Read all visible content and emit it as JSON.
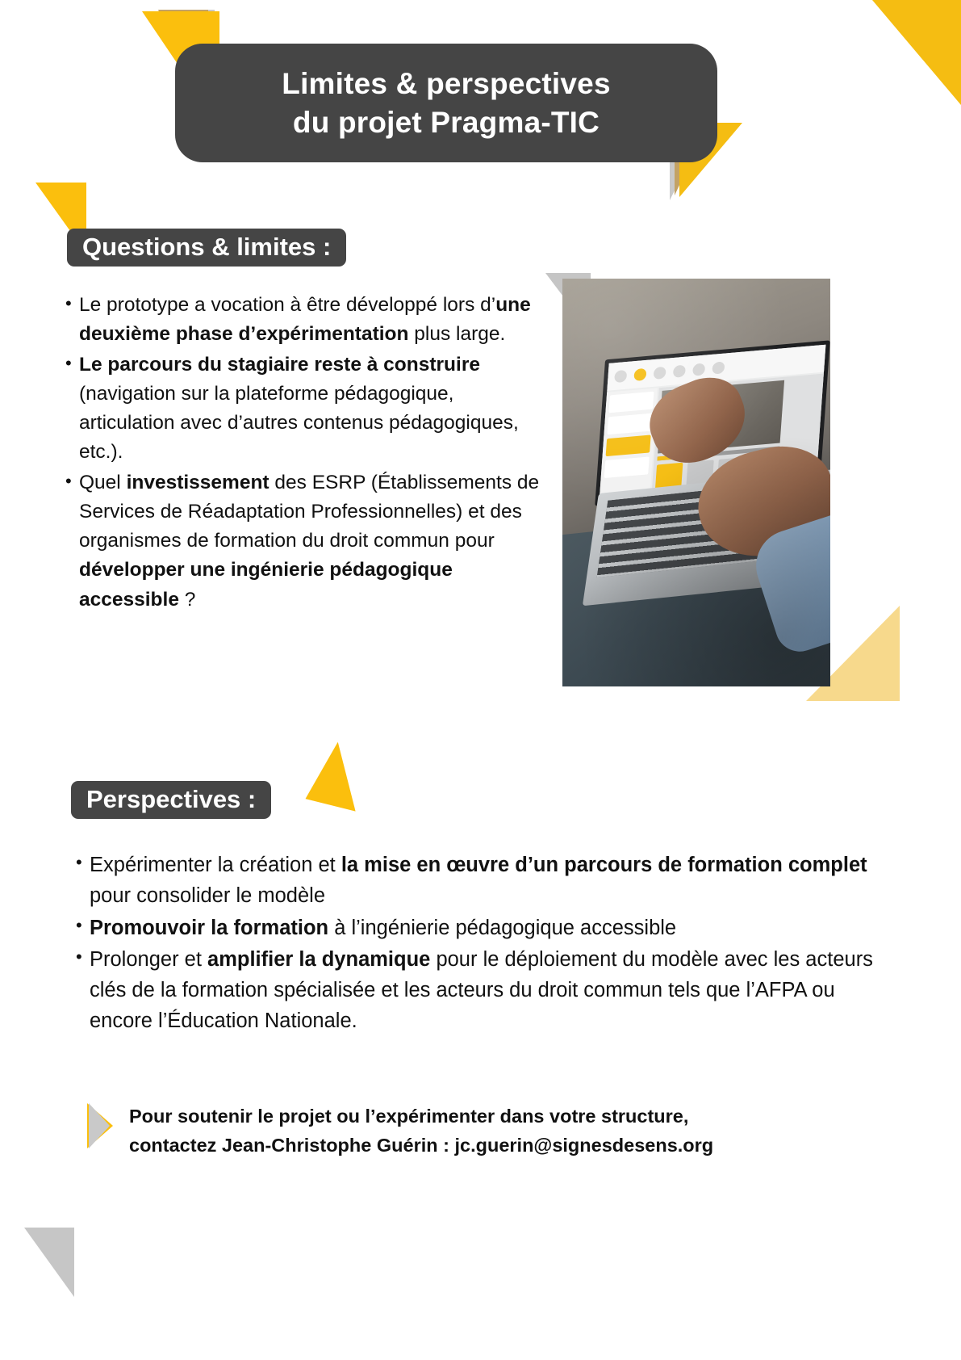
{
  "colors": {
    "dark": "#454545",
    "yellow": "#fbbf0d",
    "yellow_deep": "#f5bd12",
    "pale_yellow": "#f7d98c",
    "gray": "#c9c9c9",
    "tan": "#c3a265",
    "text": "#111111",
    "white": "#ffffff"
  },
  "title": {
    "line1": "Limites & perspectives",
    "line2": "du projet Pragma-TIC"
  },
  "sections": [
    {
      "id": "questions",
      "label": "Questions & limites :",
      "bullets": [
        [
          {
            "text": "Le prototype a vocation à être développé lors d’",
            "bold": false
          },
          {
            "text": "une deuxième phase d’expérimentation",
            "bold": true
          },
          {
            "text": " plus large.",
            "bold": false
          }
        ],
        [
          {
            "text": "Le parcours du stagiaire reste à construire",
            "bold": true
          },
          {
            "text": " (navigation sur la plateforme pédagogique, articulation avec d’autres contenus pédagogiques, etc.).",
            "bold": false
          }
        ],
        [
          {
            "text": "Quel ",
            "bold": false
          },
          {
            "text": "investissement",
            "bold": true
          },
          {
            "text": " des ESRP (Établissements de Services de Réadaptation Professionnelles) et des organismes de formation du droit commun pour ",
            "bold": false
          },
          {
            "text": "développer une ingénierie pédagogique accessible",
            "bold": true
          },
          {
            "text": " ?",
            "bold": false
          }
        ]
      ]
    },
    {
      "id": "perspectives",
      "label": "Perspectives :",
      "bullets": [
        [
          {
            "text": "Expérimenter la création et ",
            "bold": false
          },
          {
            "text": "la mise en œuvre d’un parcours de formation complet",
            "bold": true
          },
          {
            "text": " pour consolider le modèle",
            "bold": false
          }
        ],
        [
          {
            "text": "Promouvoir la formation",
            "bold": true
          },
          {
            "text": " à l’ingénierie pédagogique accessible",
            "bold": false
          }
        ],
        [
          {
            "text": "Prolonger et ",
            "bold": false
          },
          {
            "text": "amplifier la dynamique",
            "bold": true
          },
          {
            "text": " pour le déploiement du modèle avec les acteurs clés de la formation spécialisée et les acteurs du droit commun tels que l’AFPA ou encore l’Éducation Nationale.",
            "bold": false
          }
        ]
      ]
    }
  ],
  "contact": {
    "line1": "Pour soutenir le projet ou l’expérimenter dans votre structure,",
    "line2": "contactez Jean-Christophe Guérin : jc.guerin@signesdesens.org"
  },
  "photo": {
    "alt": "Personne utilisant un ordinateur portable posé sur les genoux, affichant la plateforme pédagogique",
    "screen_steps": 6
  }
}
